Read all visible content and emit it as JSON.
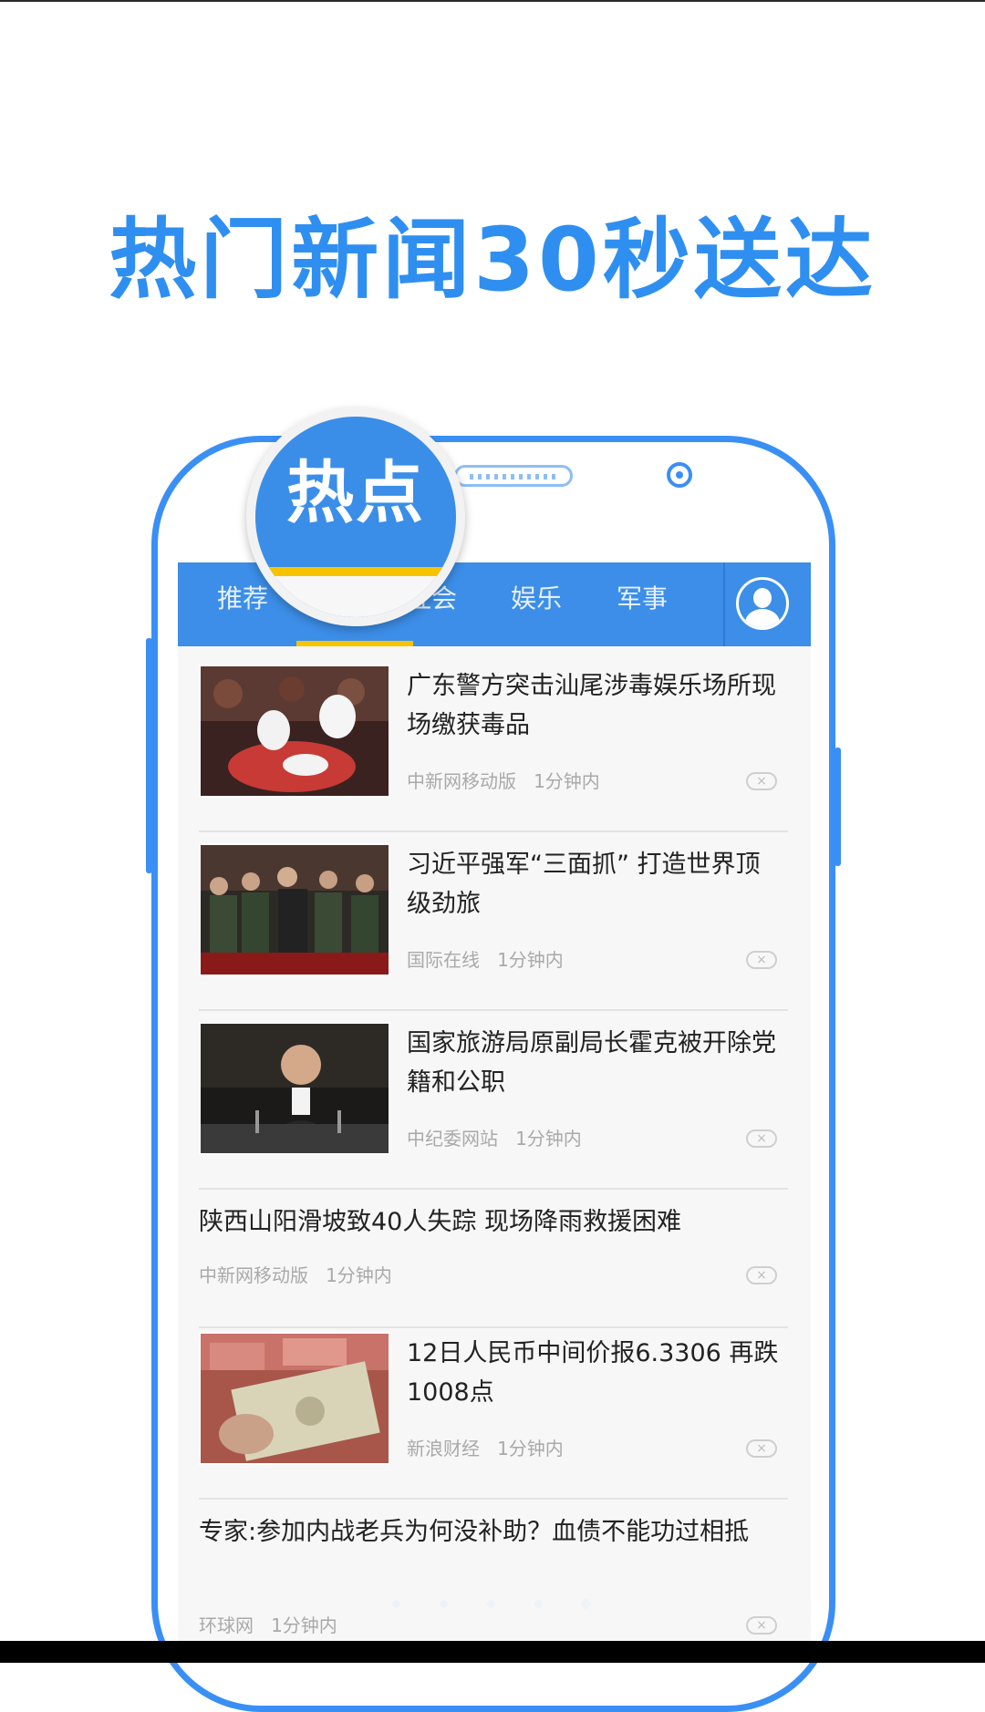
{
  "headline": "热门新闻30秒送达",
  "badge": {
    "label": "热点"
  },
  "tabs": [
    {
      "label": "推荐"
    },
    {
      "label": "热点"
    },
    {
      "label": "社会"
    },
    {
      "label": "娱乐"
    },
    {
      "label": "军事"
    }
  ],
  "active_tab": "热点",
  "news": [
    {
      "title": "广东警方突击汕尾涉毒娱乐场所现场缴获毒品",
      "source": "中新网移动版",
      "time": "1分钟内",
      "has_image": true
    },
    {
      "title": "习近平强军“三面抓” 打造世界顶级劲旅",
      "source": "国际在线",
      "time": "1分钟内",
      "has_image": true
    },
    {
      "title": "国家旅游局原副局长霍克被开除党籍和公职",
      "source": "中纪委网站",
      "time": "1分钟内",
      "has_image": true
    },
    {
      "title": "陕西山阳滑坡致40人失踪 现场降雨救援困难",
      "source": "中新网移动版",
      "time": "1分钟内",
      "has_image": false
    },
    {
      "title": "12日人民币中间价报6.3306 再跌1008点",
      "source": "新浪财经",
      "time": "1分钟内",
      "has_image": true
    },
    {
      "title": "专家:参加内战老兵为何没补助？血债不能功过相抵",
      "source": "环球网",
      "time": "1分钟内",
      "has_image": false
    }
  ],
  "close_glyph": "×",
  "colors": {
    "accent": "#3a8ee8",
    "indicator": "#f7c300",
    "headline": "#2f8ff0"
  },
  "icons": {
    "avatar": "user-avatar-icon",
    "dismiss": "close-icon"
  }
}
